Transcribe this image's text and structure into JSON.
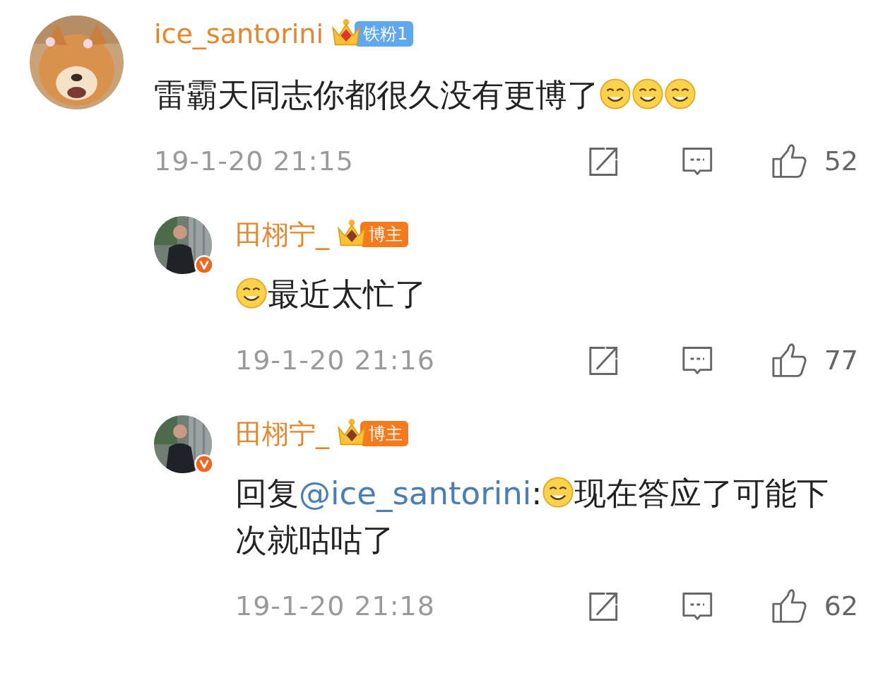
{
  "comments": [
    {
      "user": {
        "name": "ice_santorini",
        "verified": false,
        "badge": {
          "kind": "fan",
          "label": "铁粉1"
        }
      },
      "reply": false,
      "content": [
        {
          "kind": "text",
          "text": "雷霸天同志你都很久没有更博了"
        },
        {
          "kind": "emoji"
        },
        {
          "kind": "emoji"
        },
        {
          "kind": "emoji"
        }
      ],
      "time": "19-1-20 21:15",
      "likes": "52"
    },
    {
      "user": {
        "name": "田栩宁_",
        "verified": true,
        "badge": {
          "kind": "blogger",
          "label": "博主"
        }
      },
      "reply": true,
      "content": [
        {
          "kind": "emoji"
        },
        {
          "kind": "text",
          "text": "最近太忙了"
        }
      ],
      "time": "19-1-20 21:16",
      "likes": "77"
    },
    {
      "user": {
        "name": "田栩宁_",
        "verified": true,
        "badge": {
          "kind": "blogger",
          "label": "博主"
        }
      },
      "reply": true,
      "content": [
        {
          "kind": "text",
          "text": "回复"
        },
        {
          "kind": "mention",
          "text": "@ice_santorini"
        },
        {
          "kind": "text",
          "text": ":"
        },
        {
          "kind": "emoji"
        },
        {
          "kind": "text",
          "text": "现在答应了可能下次就咕咕了"
        }
      ],
      "time": "19-1-20 21:18",
      "likes": "62"
    }
  ]
}
